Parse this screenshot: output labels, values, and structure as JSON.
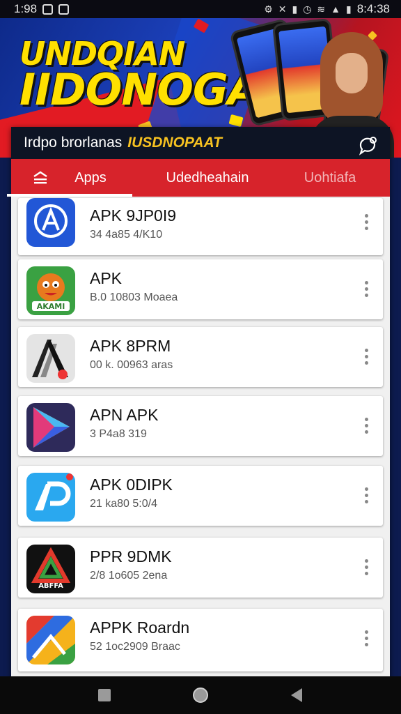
{
  "status_bar": {
    "time": "1:98",
    "clock_right": "8:4:38"
  },
  "hero": {
    "title_line1": "UNDQIAN",
    "title_line2": "IIDONOGAH"
  },
  "header": {
    "title": "Irdpo brorlanas",
    "brand": "IUSDNOPAAT"
  },
  "tabs": [
    {
      "label": "Apps",
      "active": true
    },
    {
      "label": "Udedheahain",
      "active": false
    },
    {
      "label": "Uohtiafa",
      "active": false
    }
  ],
  "apps": [
    {
      "name": "APK 9JP0I9",
      "meta": "34 4a85 4/K10",
      "icon": "circle-a-icon",
      "color": "#2257d6"
    },
    {
      "name": "APK",
      "meta": "B.0 10803 Moaea",
      "icon": "mascot-icon",
      "color": "#3aa142"
    },
    {
      "name": "APK 8PRM",
      "meta": "00 k. 00963 aras",
      "icon": "stylized-a-icon",
      "color": "#d9d9d9"
    },
    {
      "name": "APN APK",
      "meta": "3 P4a8 319",
      "icon": "play-triangle-icon",
      "color": "#f5b21b"
    },
    {
      "name": "APK 0DIPK",
      "meta": "21 ka80 5:0/4",
      "icon": "ap-logo-icon",
      "color": "#2aa8ef"
    },
    {
      "name": "PPR 9DMK",
      "meta": "2/8 1o605 2ena",
      "icon": "abfa-logo-icon",
      "color": "#111111"
    },
    {
      "name": "APPK Roardn",
      "meta": "52 1oc2909 Braac",
      "icon": "maps-icon",
      "color": "#e33b2f"
    }
  ],
  "colors": {
    "accent_red": "#d7232b",
    "header_dark": "#0d1424",
    "title_yellow": "#ffe000"
  }
}
